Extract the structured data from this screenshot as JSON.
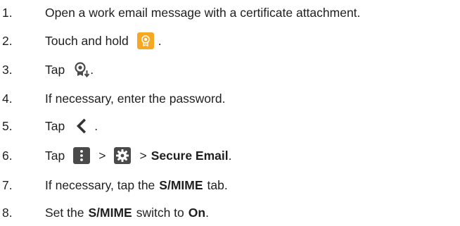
{
  "steps": [
    {
      "num": "1.",
      "text": "Open a work email message with a certificate attachment."
    },
    {
      "num": "2.",
      "text_before": "Touch and hold",
      "text_after": "."
    },
    {
      "num": "3.",
      "text_before": "Tap",
      "text_after": "."
    },
    {
      "num": "4.",
      "text": "If necessary, enter the password."
    },
    {
      "num": "5.",
      "text_before": "Tap",
      "text_after": "."
    },
    {
      "num": "6.",
      "text_before": "Tap",
      "sep1": ">",
      "sep2": ">",
      "bold": "Secure Email",
      "text_after": "."
    },
    {
      "num": "7.",
      "text_before": "If necessary, tap the",
      "bold": "S/MIME",
      "text_after": "tab."
    },
    {
      "num": "8.",
      "text_before": "Set the",
      "bold": "S/MIME",
      "text_middle": "switch to",
      "bold2": "On",
      "text_after": "."
    }
  ],
  "icons": {
    "step2": "certificate-icon",
    "step3": "import-certificate-icon",
    "step5": "back-arrow-icon",
    "step6a": "more-menu-icon",
    "step6b": "settings-gear-icon"
  },
  "colors": {
    "certificate_orange": "#f7a823",
    "icon_dark": "#4a4a4a"
  }
}
